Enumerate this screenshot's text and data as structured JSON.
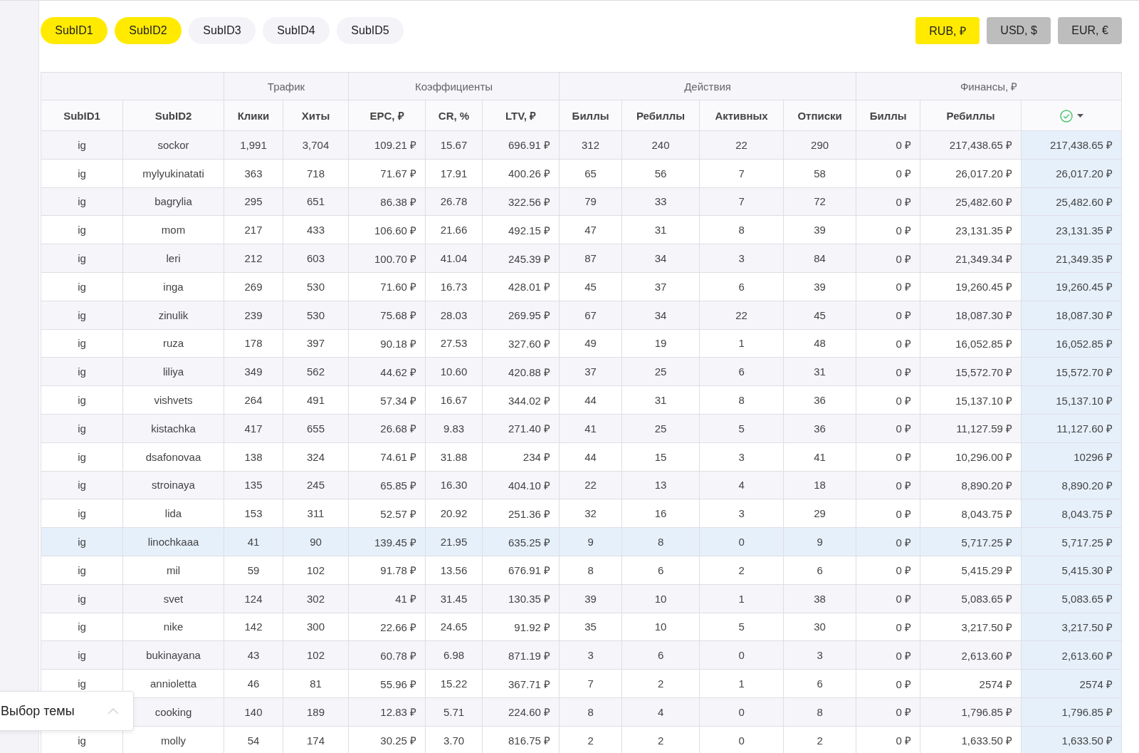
{
  "subid_filters": [
    {
      "label": "SubID1",
      "selected": true
    },
    {
      "label": "SubID2",
      "selected": true
    },
    {
      "label": "SubID3",
      "selected": false
    },
    {
      "label": "SubID4",
      "selected": false
    },
    {
      "label": "SubID5",
      "selected": false
    }
  ],
  "currencies": [
    {
      "label": "RUB, ₽",
      "selected": true
    },
    {
      "label": "USD, $",
      "selected": false
    },
    {
      "label": "EUR, €",
      "selected": false
    }
  ],
  "table": {
    "groups": [
      {
        "columns": [
          {
            "label": "SubID1"
          },
          {
            "label": "SubID2"
          }
        ]
      },
      {
        "label": "Трафик",
        "columns": [
          {
            "label": "Клики"
          },
          {
            "label": "Хиты"
          }
        ]
      },
      {
        "label": "Коэффициенты",
        "columns": [
          {
            "label": "EPC, ₽"
          },
          {
            "label": "CR, %"
          },
          {
            "label": "LTV, ₽"
          }
        ]
      },
      {
        "label": "Действия",
        "columns": [
          {
            "label": "Биллы"
          },
          {
            "label": "Ребиллы"
          },
          {
            "label": "Активных"
          },
          {
            "label": "Отписки"
          }
        ]
      },
      {
        "label": "Финансы, ₽",
        "columns": [
          {
            "label": "Биллы"
          },
          {
            "label": "Ребиллы"
          },
          {
            "kind": "status-sort"
          }
        ]
      }
    ],
    "rows": [
      {
        "selected": false,
        "subid1": "ig",
        "subid2": "sockor",
        "values": [
          "1,991",
          "3,704",
          "109.21 ₽",
          "15.67",
          "696.91 ₽",
          "312",
          "240",
          "22",
          "290",
          "0 ₽",
          "217,438.65 ₽",
          "217,438.65 ₽"
        ]
      },
      {
        "selected": false,
        "subid1": "ig",
        "subid2": "mylyukinatati",
        "values": [
          "363",
          "718",
          "71.67 ₽",
          "17.91",
          "400.26 ₽",
          "65",
          "56",
          "7",
          "58",
          "0 ₽",
          "26,017.20 ₽",
          "26,017.20 ₽"
        ]
      },
      {
        "selected": false,
        "subid1": "ig",
        "subid2": "bagrylia",
        "values": [
          "295",
          "651",
          "86.38 ₽",
          "26.78",
          "322.56 ₽",
          "79",
          "33",
          "7",
          "72",
          "0 ₽",
          "25,482.60 ₽",
          "25,482.60 ₽"
        ]
      },
      {
        "selected": false,
        "subid1": "ig",
        "subid2": "mom",
        "values": [
          "217",
          "433",
          "106.60 ₽",
          "21.66",
          "492.15 ₽",
          "47",
          "31",
          "8",
          "39",
          "0 ₽",
          "23,131.35 ₽",
          "23,131.35 ₽"
        ]
      },
      {
        "selected": false,
        "subid1": "ig",
        "subid2": "leri",
        "values": [
          "212",
          "603",
          "100.70 ₽",
          "41.04",
          "245.39 ₽",
          "87",
          "34",
          "3",
          "84",
          "0 ₽",
          "21,349.34 ₽",
          "21,349.35 ₽"
        ]
      },
      {
        "selected": false,
        "subid1": "ig",
        "subid2": "inga",
        "values": [
          "269",
          "530",
          "71.60 ₽",
          "16.73",
          "428.01 ₽",
          "45",
          "37",
          "6",
          "39",
          "0 ₽",
          "19,260.45 ₽",
          "19,260.45 ₽"
        ]
      },
      {
        "selected": false,
        "subid1": "ig",
        "subid2": "zinulik",
        "values": [
          "239",
          "530",
          "75.68 ₽",
          "28.03",
          "269.95 ₽",
          "67",
          "34",
          "22",
          "45",
          "0 ₽",
          "18,087.30 ₽",
          "18,087.30 ₽"
        ]
      },
      {
        "selected": false,
        "subid1": "ig",
        "subid2": "ruza",
        "values": [
          "178",
          "397",
          "90.18 ₽",
          "27.53",
          "327.60 ₽",
          "49",
          "19",
          "1",
          "48",
          "0 ₽",
          "16,052.85 ₽",
          "16,052.85 ₽"
        ]
      },
      {
        "selected": false,
        "subid1": "ig",
        "subid2": "liliya",
        "values": [
          "349",
          "562",
          "44.62 ₽",
          "10.60",
          "420.88 ₽",
          "37",
          "25",
          "6",
          "31",
          "0 ₽",
          "15,572.70 ₽",
          "15,572.70 ₽"
        ]
      },
      {
        "selected": false,
        "subid1": "ig",
        "subid2": "vishvets",
        "values": [
          "264",
          "491",
          "57.34 ₽",
          "16.67",
          "344.02 ₽",
          "44",
          "31",
          "8",
          "36",
          "0 ₽",
          "15,137.10 ₽",
          "15,137.10 ₽"
        ]
      },
      {
        "selected": false,
        "subid1": "ig",
        "subid2": "kistachka",
        "values": [
          "417",
          "655",
          "26.68 ₽",
          "9.83",
          "271.40 ₽",
          "41",
          "25",
          "5",
          "36",
          "0 ₽",
          "11,127.59 ₽",
          "11,127.60 ₽"
        ]
      },
      {
        "selected": false,
        "subid1": "ig",
        "subid2": "dsafonovaa",
        "values": [
          "138",
          "324",
          "74.61 ₽",
          "31.88",
          "234 ₽",
          "44",
          "15",
          "3",
          "41",
          "0 ₽",
          "10,296.00 ₽",
          "10296 ₽"
        ]
      },
      {
        "selected": false,
        "subid1": "ig",
        "subid2": "stroinaya",
        "values": [
          "135",
          "245",
          "65.85 ₽",
          "16.30",
          "404.10 ₽",
          "22",
          "13",
          "4",
          "18",
          "0 ₽",
          "8,890.20 ₽",
          "8,890.20 ₽"
        ]
      },
      {
        "selected": false,
        "subid1": "ig",
        "subid2": "lida",
        "values": [
          "153",
          "311",
          "52.57 ₽",
          "20.92",
          "251.36 ₽",
          "32",
          "16",
          "3",
          "29",
          "0 ₽",
          "8,043.75 ₽",
          "8,043.75 ₽"
        ]
      },
      {
        "selected": true,
        "subid1": "ig",
        "subid2": "linochkaaa",
        "values": [
          "41",
          "90",
          "139.45 ₽",
          "21.95",
          "635.25 ₽",
          "9",
          "8",
          "0",
          "9",
          "0 ₽",
          "5,717.25 ₽",
          "5,717.25 ₽"
        ]
      },
      {
        "selected": false,
        "subid1": "ig",
        "subid2": "mil",
        "values": [
          "59",
          "102",
          "91.78 ₽",
          "13.56",
          "676.91 ₽",
          "8",
          "6",
          "2",
          "6",
          "0 ₽",
          "5,415.29 ₽",
          "5,415.30 ₽"
        ]
      },
      {
        "selected": false,
        "subid1": "ig",
        "subid2": "svet",
        "values": [
          "124",
          "302",
          "41 ₽",
          "31.45",
          "130.35 ₽",
          "39",
          "10",
          "1",
          "38",
          "0 ₽",
          "5,083.65 ₽",
          "5,083.65 ₽"
        ]
      },
      {
        "selected": false,
        "subid1": "ig",
        "subid2": "nike",
        "values": [
          "142",
          "300",
          "22.66 ₽",
          "24.65",
          "91.92 ₽",
          "35",
          "10",
          "5",
          "30",
          "0 ₽",
          "3,217.50 ₽",
          "3,217.50 ₽"
        ]
      },
      {
        "selected": false,
        "subid1": "ig",
        "subid2": "bukinayana",
        "values": [
          "43",
          "102",
          "60.78 ₽",
          "6.98",
          "871.19 ₽",
          "3",
          "6",
          "0",
          "3",
          "0 ₽",
          "2,613.60 ₽",
          "2,613.60 ₽"
        ]
      },
      {
        "selected": false,
        "subid1": "ig",
        "subid2": "annioletta",
        "values": [
          "46",
          "81",
          "55.96 ₽",
          "15.22",
          "367.71 ₽",
          "7",
          "2",
          "1",
          "6",
          "0 ₽",
          "2574 ₽",
          "2574 ₽"
        ]
      },
      {
        "selected": false,
        "subid2": "cooking",
        "values": [
          "140",
          "189",
          "12.83 ₽",
          "5.71",
          "224.60 ₽",
          "8",
          "4",
          "0",
          "8",
          "0 ₽",
          "1,796.85 ₽",
          "1,796.85 ₽"
        ]
      },
      {
        "selected": false,
        "subid1": "ig",
        "subid2": "molly",
        "values": [
          "54",
          "174",
          "30.25 ₽",
          "3.70",
          "816.75 ₽",
          "2",
          "2",
          "0",
          "2",
          "0 ₽",
          "1,633.50 ₽",
          "1,633.50 ₽"
        ]
      }
    ]
  },
  "theme_picker": {
    "label": "Выбор темы",
    "expanded": false
  }
}
